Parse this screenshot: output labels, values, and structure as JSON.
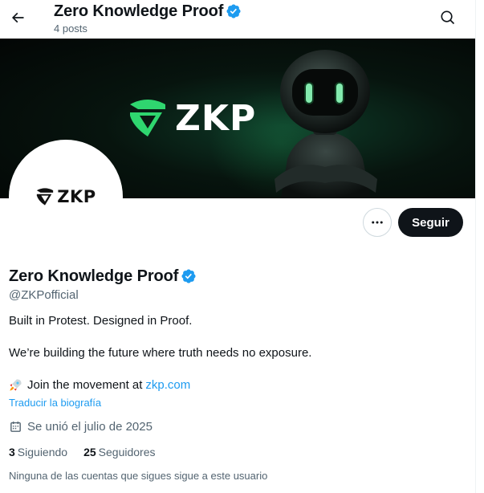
{
  "header": {
    "title": "Zero Knowledge Proof",
    "post_count": "4 posts"
  },
  "banner": {
    "logo_text": "ZKP"
  },
  "avatar": {
    "logo_text": "ZKP"
  },
  "actions": {
    "follow_label": "Seguir"
  },
  "profile": {
    "name": "Zero Knowledge Proof",
    "handle": "@ZKPofficial",
    "bio_line1": "Built in Protest. Designed in Proof.",
    "bio_line2": "We’re building the future where truth needs no exposure.",
    "bio_line3_prefix": "Join the movement at",
    "bio_link": "zkp.com",
    "translate_label": "Traducir la biografía",
    "joined": "Se unió el julio de 2025",
    "following_count": "3",
    "following_label": "Siguiendo",
    "followers_count": "25",
    "followers_label": "Seguidores",
    "followers_note": "Ninguna de las cuentas que sigues sigue a este usuario"
  },
  "colors": {
    "accent": "#1d9bf0",
    "brand_green": "#2fd66f",
    "follow_button": "#0f1419"
  },
  "icons": {
    "back": "arrow-left-icon",
    "search": "search-icon",
    "verified": "verified-badge-icon",
    "more": "more-horizontal-icon",
    "rocket": "rocket-icon",
    "calendar": "calendar-icon"
  }
}
